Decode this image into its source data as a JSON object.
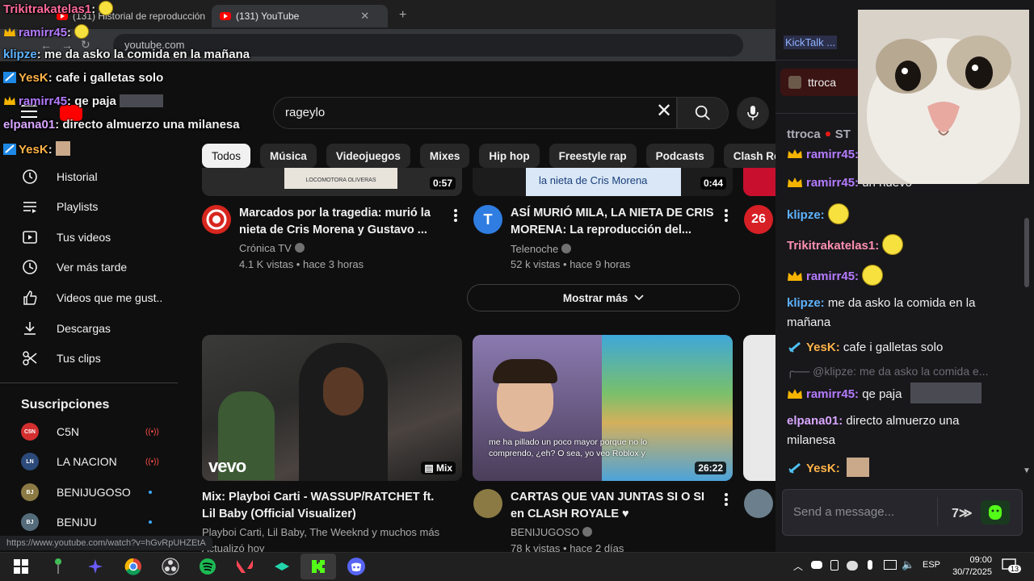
{
  "browser": {
    "tabs": [
      {
        "label": "(131) Historial de reproducción"
      },
      {
        "label": "(131) YouTube"
      }
    ],
    "url": "youtube.com",
    "status_url": "https://www.youtube.com/watch?v=hGvRpUHZEtA"
  },
  "youtube": {
    "search_query": "rageylo",
    "chips": [
      "Todos",
      "Música",
      "Videojuegos",
      "Mixes",
      "Hip hop",
      "Freestyle rap",
      "Podcasts",
      "Clash Royale"
    ],
    "sidebar": [
      {
        "label": "Historial",
        "icon": "history-icon"
      },
      {
        "label": "Playlists",
        "icon": "playlists-icon"
      },
      {
        "label": "Tus videos",
        "icon": "your-videos-icon"
      },
      {
        "label": "Ver más tarde",
        "icon": "watch-later-icon"
      },
      {
        "label": "Videos que me gust...",
        "icon": "thumbs-up-icon"
      },
      {
        "label": "Descargas",
        "icon": "download-icon"
      },
      {
        "label": "Tus clips",
        "icon": "scissors-icon"
      }
    ],
    "subscriptions_title": "Suscripciones",
    "subscriptions": [
      {
        "name": "C5N",
        "avatar": "C5N",
        "color": "#d32f2f",
        "status": "live"
      },
      {
        "name": "LA NACION",
        "avatar": "LN",
        "color": "#2c4a7a",
        "status": "live"
      },
      {
        "name": "BENIJUGOSO",
        "avatar": "BJ",
        "color": "#8b7a44",
        "status": "new"
      },
      {
        "name": "BENIJU",
        "avatar": "BJ",
        "color": "#546b7a",
        "status": "new"
      }
    ],
    "top_videos": [
      {
        "duration": "0:57",
        "title": "Marcados por la tragedia: murió la nieta de Cris Morena y Gustavo ...",
        "channel": "Crónica TV",
        "meta": "4.1 K vistas • hace 3 horas",
        "avatar_color": "#d7261e",
        "thumb_caption": "LOCOMOTORA OLIVERAS"
      },
      {
        "duration": "0:44",
        "title": "ASÍ MURIÓ MILA, LA NIETA DE CRIS MORENA: La reproducción del...",
        "channel": "Telenoche",
        "meta": "52 k vistas • hace 9 horas",
        "avatar_color": "#2f7de1",
        "thumb_caption": "la nieta de Cris Morena"
      }
    ],
    "third_avatar_label": "26",
    "show_more": "Mostrar más",
    "bottom_videos": [
      {
        "duration": "Mix",
        "title": "Mix: Playboi Carti - WASSUP/RATCHET ft. Lil Baby (Official Visualizer)",
        "channel": "Playboi Carti, Lil Baby, The Weeknd y muchos más",
        "meta": "Actualizó hoy",
        "thumb_watermark": "vevo"
      },
      {
        "duration": "26:22",
        "title": "CARTAS QUE VAN JUNTAS SI O SI en CLASH ROYALE ♥",
        "channel": "BENIJUGOSO",
        "meta": "78 k vistas • hace 2 días",
        "thumb_subtitle": "me ha pillado un poco mayor porque no lo comprendo, ¿eh? O sea, yo veo Roblox y"
      }
    ]
  },
  "overlay_chat": [
    {
      "user": "Trikitrakatelas1",
      "text": ":",
      "color": "#ff6b9a",
      "badge": "none",
      "emote": true
    },
    {
      "user": "ramirr45",
      "text": ":",
      "color": "#b57bff",
      "badge": "crown",
      "emote": true
    },
    {
      "user": "klipze",
      "text": ": me da asko la comida en la mañana",
      "color": "#5eb3ff",
      "badge": "none",
      "emote": false
    },
    {
      "user": "YesK",
      "text": ": cafe i galletas solo",
      "color": "#ffb347",
      "badge": "sword",
      "emote": false
    },
    {
      "user": "ramirr45",
      "text": ": qe paja",
      "color": "#b57bff",
      "badge": "crown",
      "emote": false
    },
    {
      "user": "elpana01",
      "text": ": directo almuerzo una milanesa",
      "color": "#d8a6ff",
      "badge": "none",
      "emote": false
    },
    {
      "user": "YesK",
      "text": ":",
      "color": "#ffb347",
      "badge": "sword",
      "emote": false
    }
  ],
  "chat_panel": {
    "app_name": "KickTalk ...",
    "tab_channel": "ttroca",
    "header_channel": "ttroca",
    "header_suffix": "ST",
    "partial_top": "ramirr45:",
    "messages": [
      {
        "user": "ramirr45:",
        "text": "un nuevo",
        "color": "#b57bff",
        "badge": "crown",
        "emote": false
      },
      {
        "user": "klipze:",
        "text": "",
        "color": "#5eb3ff",
        "badge": "none",
        "emote": true
      },
      {
        "user": "Trikitrakatelas1:",
        "text": "",
        "color": "#ff8fb0",
        "badge": "none",
        "emote": true
      },
      {
        "user": "ramirr45:",
        "text": "",
        "color": "#b57bff",
        "badge": "crown",
        "emote": true
      },
      {
        "user": "klipze:",
        "text": "me da asko la comida en la mañana",
        "color": "#5eb3ff",
        "badge": "none",
        "emote": false
      },
      {
        "user": "YesK:",
        "text": "cafe i galletas solo",
        "color": "#ffb347",
        "badge": "sword",
        "emote": false
      },
      {
        "user": "ramirr45:",
        "text": "qe paja",
        "color": "#b57bff",
        "badge": "crown",
        "emote": false
      },
      {
        "user": "elpana01:",
        "text": "directo almuerzo una milanesa",
        "color": "#d8a6ff",
        "badge": "none",
        "emote": false
      },
      {
        "user": "YesK:",
        "text": "",
        "color": "#ffb347",
        "badge": "sword",
        "emote": false
      }
    ],
    "reply_preview": "@klipze: me da asko la comida e...",
    "input_placeholder": "Send a message..."
  },
  "taskbar": {
    "icons": [
      "windows-start-icon",
      "joystick-icon",
      "app-icon",
      "chrome-icon",
      "obs-icon",
      "spotify-icon",
      "valorant-icon",
      "app2-icon",
      "kick-icon",
      "discord-icon"
    ],
    "language": "ESP",
    "time": "09:00",
    "date": "30/7/2025",
    "notifications": "13"
  }
}
